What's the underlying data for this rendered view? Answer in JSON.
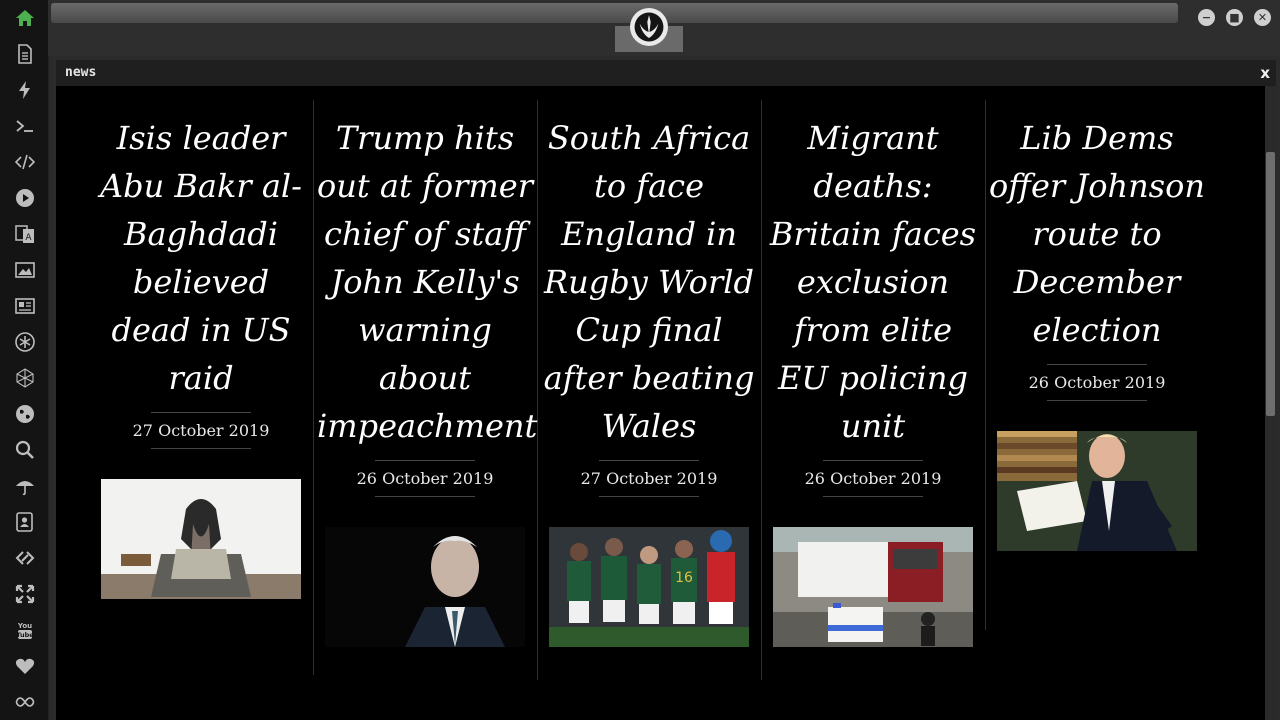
{
  "window": {
    "title": "news",
    "close_label": "x"
  },
  "sidebar": {
    "icons": [
      "home-icon",
      "document-icon",
      "lightning-icon",
      "terminal-icon",
      "code-icon",
      "play-icon",
      "translate-icon",
      "image-icon",
      "newspaper-icon",
      "asterisk-icon",
      "polyhedron-icon",
      "globe-icon",
      "search-icon",
      "umbrella-icon",
      "contacts-icon",
      "link-icon",
      "expand-icon",
      "youtube-icon",
      "heart-icon",
      "infinity-icon"
    ],
    "accent": "#4caf50"
  },
  "articles": [
    {
      "headline": "Isis leader Abu Bakr al-Baghdadi believed dead in US raid",
      "date": "27 October 2019"
    },
    {
      "headline": "Trump hits out at former chief of staff John Kelly's warning about impeachment",
      "date": "26 October 2019"
    },
    {
      "headline": "South Africa to face England in Rugby World Cup final after beating Wales",
      "date": "27 October 2019"
    },
    {
      "headline": "Migrant deaths: Britain faces exclusion from elite EU policing unit",
      "date": "26 October 2019"
    },
    {
      "headline": "Lib Dems offer Johnson route to December election",
      "date": "26 October 2019"
    }
  ],
  "youtube_label": "You Tube"
}
